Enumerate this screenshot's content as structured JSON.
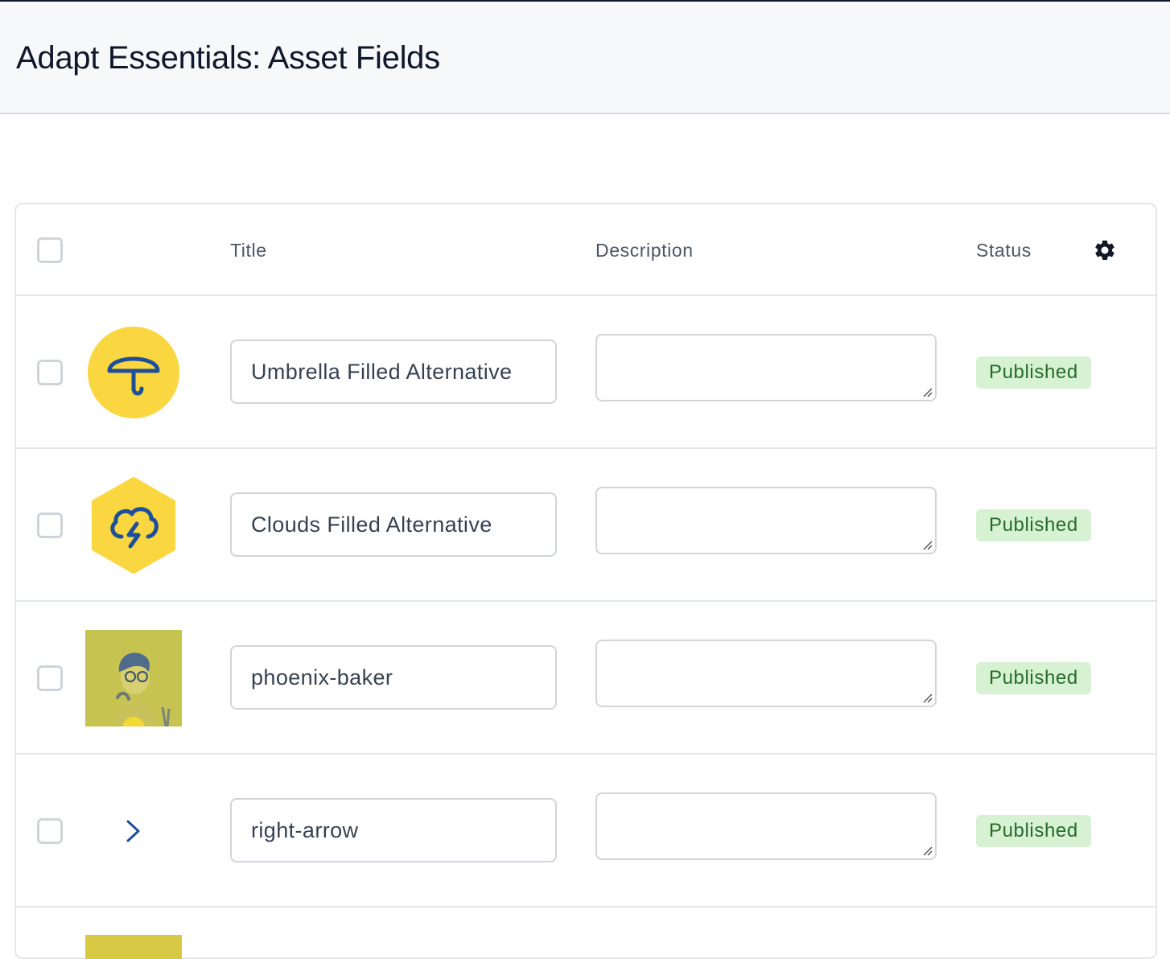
{
  "page": {
    "title": "Adapt Essentials: Asset Fields"
  },
  "table": {
    "columns": {
      "title": "Title",
      "description": "Description",
      "status": "Status"
    },
    "settings_icon": "gear-icon",
    "rows": [
      {
        "thumbnail": "umbrella-icon",
        "title": "Umbrella Filled Alternative",
        "description": "",
        "status": "Published"
      },
      {
        "thumbnail": "cloud-lightning-icon",
        "title": "Clouds Filled Alternative",
        "description": "",
        "status": "Published"
      },
      {
        "thumbnail": "portrait-photo",
        "title": "phoenix-baker",
        "description": "",
        "status": "Published"
      },
      {
        "thumbnail": "chevron-right-icon",
        "title": "right-arrow",
        "description": "",
        "status": "Published"
      }
    ]
  },
  "colors": {
    "accent_yellow": "#fad640",
    "icon_blue": "#1e4f9a",
    "badge_bg": "#d7f2d3",
    "badge_text": "#256b2a"
  }
}
